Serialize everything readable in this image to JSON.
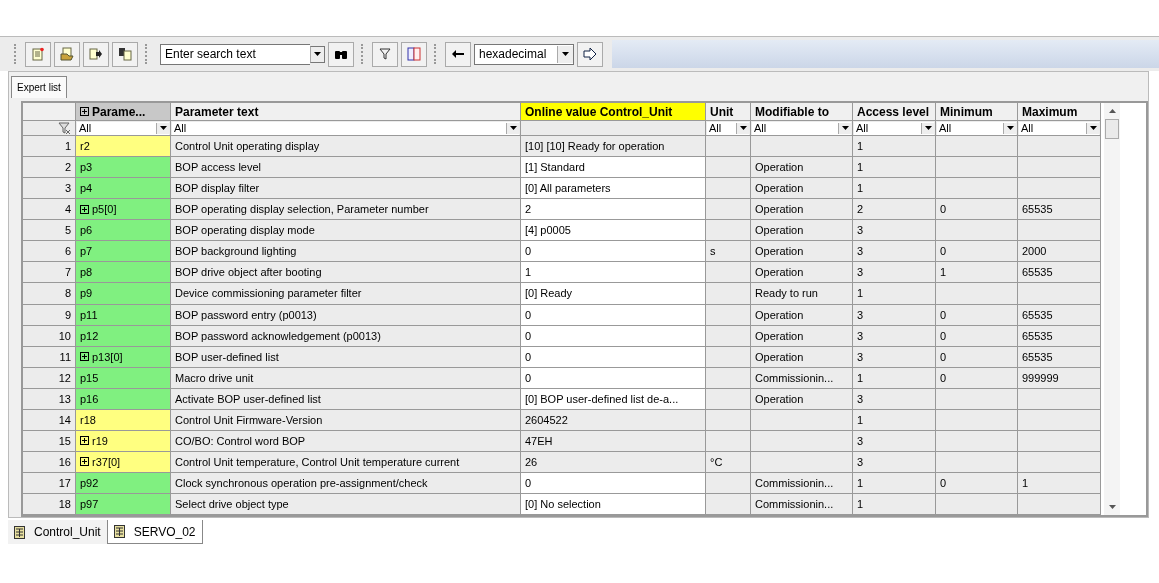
{
  "toolbar": {
    "search": {
      "placeholder": "Enter search text"
    },
    "number_format": {
      "value": "hexadecimal"
    }
  },
  "view_tabs": [
    {
      "label": "Expert list",
      "selected": true
    }
  ],
  "table": {
    "columns": [
      {
        "label": "Parame...",
        "kind": "expand",
        "sorted": true,
        "highlight": false
      },
      {
        "label": "Parameter text",
        "kind": "text",
        "sorted": false,
        "highlight": false
      },
      {
        "label": "Online value Control_Unit",
        "kind": "text",
        "sorted": false,
        "highlight": true
      },
      {
        "label": "Unit",
        "kind": "text",
        "sorted": false,
        "highlight": false
      },
      {
        "label": "Modifiable to",
        "kind": "text",
        "sorted": false,
        "highlight": false
      },
      {
        "label": "Access level",
        "kind": "text",
        "sorted": false,
        "highlight": false
      },
      {
        "label": "Minimum",
        "kind": "text",
        "sorted": false,
        "highlight": false
      },
      {
        "label": "Maximum",
        "kind": "text",
        "sorted": false,
        "highlight": false
      }
    ],
    "filters": [
      {
        "value": "All",
        "kind": "wide"
      },
      {
        "value": "All",
        "kind": "wide"
      },
      {
        "kind": "none"
      },
      {
        "value": "All",
        "kind": "narrow"
      },
      {
        "value": "All",
        "kind": "wide"
      },
      {
        "value": "All",
        "kind": "wide"
      },
      {
        "value": "All",
        "kind": "wide"
      },
      {
        "value": "All",
        "kind": "wide"
      }
    ],
    "rows": [
      {
        "number": "1",
        "parameter": "r2",
        "expandable": false,
        "color": "#ffff80",
        "text": "Control Unit operating display",
        "value": "[10] [10] Ready for operation",
        "editable": false,
        "unit": "",
        "modifiable": "",
        "access": "1",
        "minimum": "",
        "maximum": ""
      },
      {
        "number": "2",
        "parameter": "p3",
        "expandable": false,
        "color": "#80f080",
        "text": "BOP access level",
        "value": "[1] Standard",
        "editable": true,
        "unit": "",
        "modifiable": "Operation",
        "access": "1",
        "minimum": "",
        "maximum": ""
      },
      {
        "number": "3",
        "parameter": "p4",
        "expandable": false,
        "color": "#80f080",
        "text": "BOP display filter",
        "value": "[0] All parameters",
        "editable": true,
        "unit": "",
        "modifiable": "Operation",
        "access": "1",
        "minimum": "",
        "maximum": ""
      },
      {
        "number": "4",
        "parameter": "p5[0]",
        "expandable": true,
        "color": "#80f080",
        "text": "BOP operating display selection, Parameter number",
        "value": "2",
        "editable": true,
        "unit": "",
        "modifiable": "Operation",
        "access": "2",
        "minimum": "0",
        "maximum": "65535"
      },
      {
        "number": "5",
        "parameter": "p6",
        "expandable": false,
        "color": "#80f080",
        "text": "BOP operating display mode",
        "value": "[4] p0005",
        "editable": true,
        "unit": "",
        "modifiable": "Operation",
        "access": "3",
        "minimum": "",
        "maximum": ""
      },
      {
        "number": "6",
        "parameter": "p7",
        "expandable": false,
        "color": "#80f080",
        "text": "BOP background lighting",
        "value": "0",
        "editable": true,
        "unit": "s",
        "modifiable": "Operation",
        "access": "3",
        "minimum": "0",
        "maximum": "2000"
      },
      {
        "number": "7",
        "parameter": "p8",
        "expandable": false,
        "color": "#80f080",
        "text": "BOP drive object after booting",
        "value": "1",
        "editable": true,
        "unit": "",
        "modifiable": "Operation",
        "access": "3",
        "minimum": "1",
        "maximum": "65535"
      },
      {
        "number": "8",
        "parameter": "p9",
        "expandable": false,
        "color": "#80f080",
        "text": "Device commissioning parameter filter",
        "value": "[0] Ready",
        "editable": true,
        "unit": "",
        "modifiable": "Ready to run",
        "access": "1",
        "minimum": "",
        "maximum": ""
      },
      {
        "number": "9",
        "parameter": "p11",
        "expandable": false,
        "color": "#80f080",
        "text": "BOP password entry (p0013)",
        "value": "0",
        "editable": true,
        "unit": "",
        "modifiable": "Operation",
        "access": "3",
        "minimum": "0",
        "maximum": "65535"
      },
      {
        "number": "10",
        "parameter": "p12",
        "expandable": false,
        "color": "#80f080",
        "text": "BOP password acknowledgement (p0013)",
        "value": "0",
        "editable": true,
        "unit": "",
        "modifiable": "Operation",
        "access": "3",
        "minimum": "0",
        "maximum": "65535"
      },
      {
        "number": "11",
        "parameter": "p13[0]",
        "expandable": true,
        "color": "#80f080",
        "text": "BOP user-defined list",
        "value": "0",
        "editable": true,
        "unit": "",
        "modifiable": "Operation",
        "access": "3",
        "minimum": "0",
        "maximum": "65535"
      },
      {
        "number": "12",
        "parameter": "p15",
        "expandable": false,
        "color": "#80f080",
        "text": "Macro drive unit",
        "value": "0",
        "editable": true,
        "unit": "",
        "modifiable": "Commissionin...",
        "access": "1",
        "minimum": "0",
        "maximum": "999999"
      },
      {
        "number": "13",
        "parameter": "p16",
        "expandable": false,
        "color": "#80f080",
        "text": "Activate BOP user-defined list",
        "value": "[0] BOP user-defined list de-a...",
        "editable": true,
        "unit": "",
        "modifiable": "Operation",
        "access": "3",
        "minimum": "",
        "maximum": ""
      },
      {
        "number": "14",
        "parameter": "r18",
        "expandable": false,
        "color": "#ffff80",
        "text": "Control Unit Firmware-Version",
        "value": "2604522",
        "editable": false,
        "unit": "",
        "modifiable": "",
        "access": "1",
        "minimum": "",
        "maximum": ""
      },
      {
        "number": "15",
        "parameter": "r19",
        "expandable": true,
        "color": "#ffff80",
        "text": "CO/BO: Control word BOP",
        "value": "47EH",
        "editable": false,
        "unit": "",
        "modifiable": "",
        "access": "3",
        "minimum": "",
        "maximum": ""
      },
      {
        "number": "16",
        "parameter": "r37[0]",
        "expandable": true,
        "color": "#ffff80",
        "text": "Control Unit temperature, Control Unit temperature current",
        "value": "26",
        "editable": false,
        "unit": "°C",
        "modifiable": "",
        "access": "3",
        "minimum": "",
        "maximum": ""
      },
      {
        "number": "17",
        "parameter": "p92",
        "expandable": false,
        "color": "#80f080",
        "text": "Clock synchronous operation pre-assignment/check",
        "value": "0",
        "editable": true,
        "unit": "",
        "modifiable": "Commissionin...",
        "access": "1",
        "minimum": "0",
        "maximum": "1"
      },
      {
        "number": "18",
        "parameter": "p97",
        "expandable": false,
        "color": "#80f080",
        "text": "Select drive object type",
        "value": "[0] No selection",
        "editable": true,
        "unit": "",
        "modifiable": "Commissionin...",
        "access": "1",
        "minimum": "",
        "maximum": ""
      }
    ]
  },
  "object_tabs": [
    {
      "label": "Control_Unit",
      "selected": true
    },
    {
      "label": "SERVO_02",
      "selected": false
    }
  ]
}
